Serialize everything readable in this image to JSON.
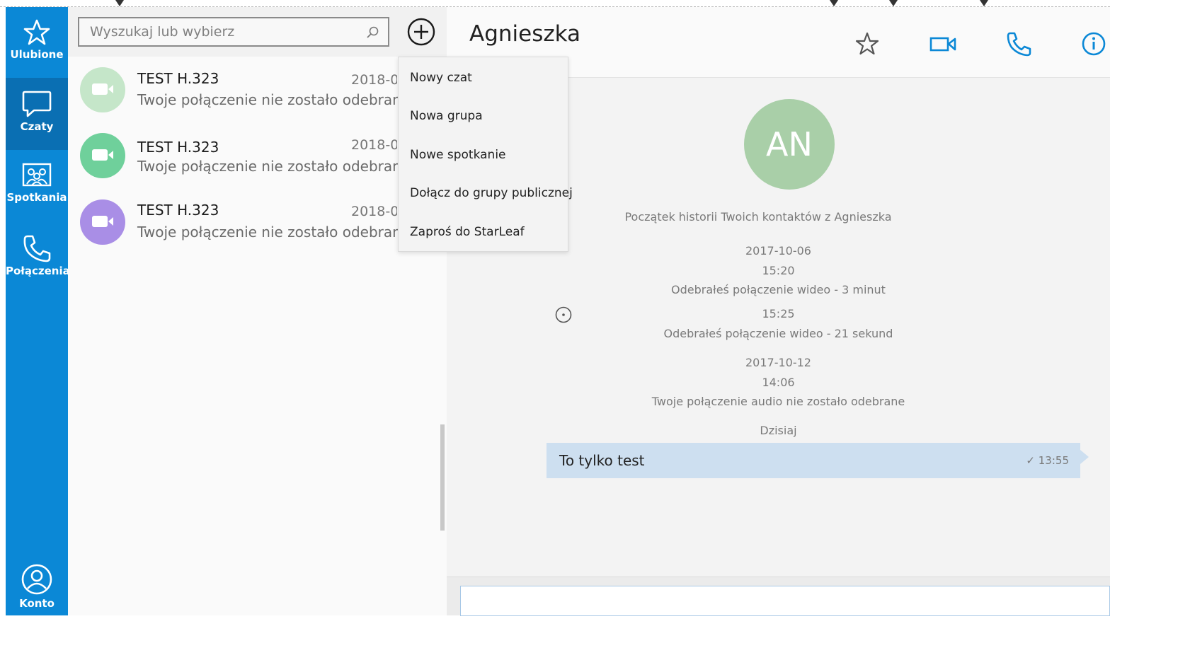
{
  "rail": {
    "items": [
      {
        "label": "Ulubione",
        "icon": "star-icon"
      },
      {
        "label": "Czaty",
        "icon": "chat-bubble-icon"
      },
      {
        "label": "Spotkania",
        "icon": "meeting-icon"
      },
      {
        "label": "Połączenia",
        "icon": "phone-icon"
      }
    ],
    "account": {
      "label": "Konto",
      "icon": "account-icon"
    },
    "color": "#0b88d6",
    "active_color": "#0a6fb3"
  },
  "search": {
    "placeholder": "Wyszukaj lub wybierz"
  },
  "chats": [
    {
      "name": "TEST H.323",
      "date": "2018-0",
      "message": "Twoje połączenie nie zostało odebrane",
      "color": "#c5e6c9"
    },
    {
      "name": "TEST H.323",
      "date": "2018-0",
      "message": "Twoje połączenie nie zostało odebrane",
      "color": "#6fd09b"
    },
    {
      "name": "TEST H.323",
      "date": "2018-0",
      "message": "Twoje połączenie nie zostało odebrane",
      "color": "#a98ee6"
    }
  ],
  "menu": {
    "items": [
      {
        "label": "Nowy czat"
      },
      {
        "label": "Nowa grupa"
      },
      {
        "label": "Nowe spotkanie"
      },
      {
        "label": "Dołącz do grupy publicznej"
      },
      {
        "label": "Zaproś do StarLeaf"
      }
    ]
  },
  "conversation": {
    "title": "Agnieszka",
    "avatar_initials": "AN",
    "history_start": "Początek historii Twoich kontaktów z Agnieszka",
    "history": [
      {
        "kind": "date",
        "text": "2017-10-06"
      },
      {
        "kind": "time",
        "text": "15:20"
      },
      {
        "kind": "event",
        "text": "Odebrałeś połączenie wideo - 3 minut"
      },
      {
        "kind": "time",
        "text": "15:25"
      },
      {
        "kind": "event",
        "text": "Odebrałeś połączenie wideo - 21 sekund"
      },
      {
        "kind": "date",
        "text": "2017-10-12"
      },
      {
        "kind": "time",
        "text": "14:06"
      },
      {
        "kind": "event",
        "text": "Twoje połączenie audio nie zostało odebrane"
      },
      {
        "kind": "date",
        "text": "Dzisiaj"
      }
    ],
    "message": {
      "text": "To tylko test",
      "time": "✓ 13:55"
    }
  }
}
